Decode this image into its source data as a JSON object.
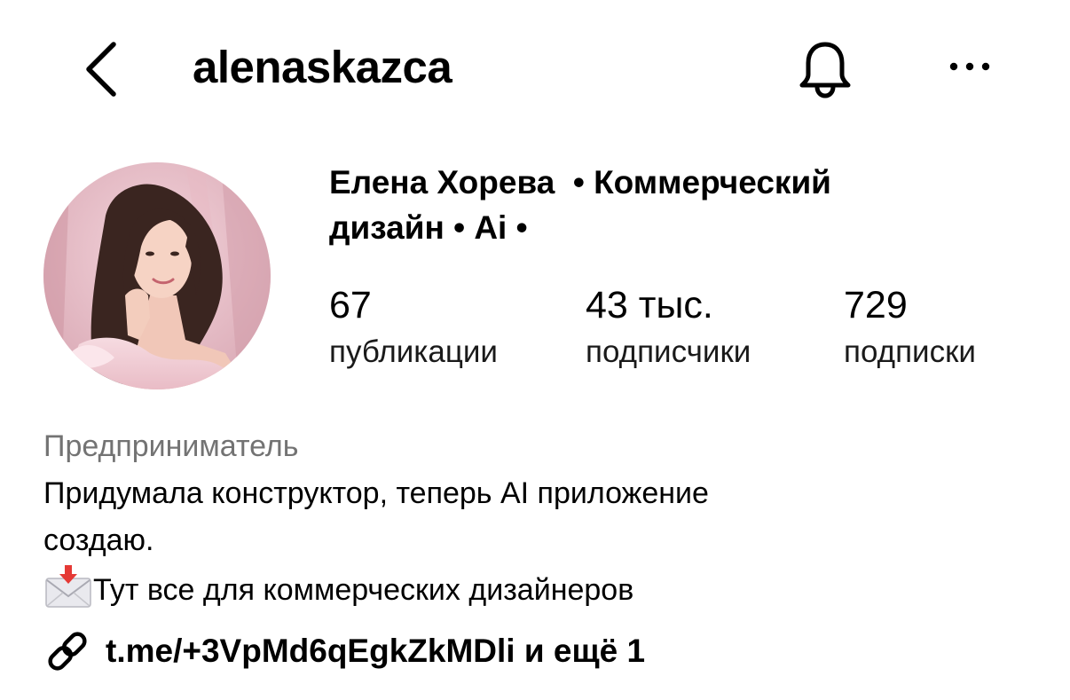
{
  "header": {
    "username": "alenaskazca",
    "icons": {
      "back": "chevron-left-icon",
      "notifications": "bell-icon",
      "more": "more-horizontal-icon"
    }
  },
  "profile": {
    "name_line1": "Елена Хорева  • Коммерческий",
    "name_line2": "дизайн • Ai •",
    "stats": [
      {
        "value": "67",
        "label": "публикации"
      },
      {
        "value": "43 тыс.",
        "label": "подписчики"
      },
      {
        "value": "729",
        "label": "подписки"
      }
    ]
  },
  "bio": {
    "category": "Предприниматель",
    "line1": "Придумала конструктор, теперь AI приложение",
    "line2": "создаю.",
    "line3": "Тут все для коммерческих дизайнеров",
    "line3_icon": "incoming-envelope-icon",
    "link": "t.me/+3VpMd6qEgkZkMDli и ещё 1",
    "link_icon": "link-icon"
  },
  "colors": {
    "text": "#000000",
    "secondary_text": "#737373",
    "background": "#ffffff"
  }
}
